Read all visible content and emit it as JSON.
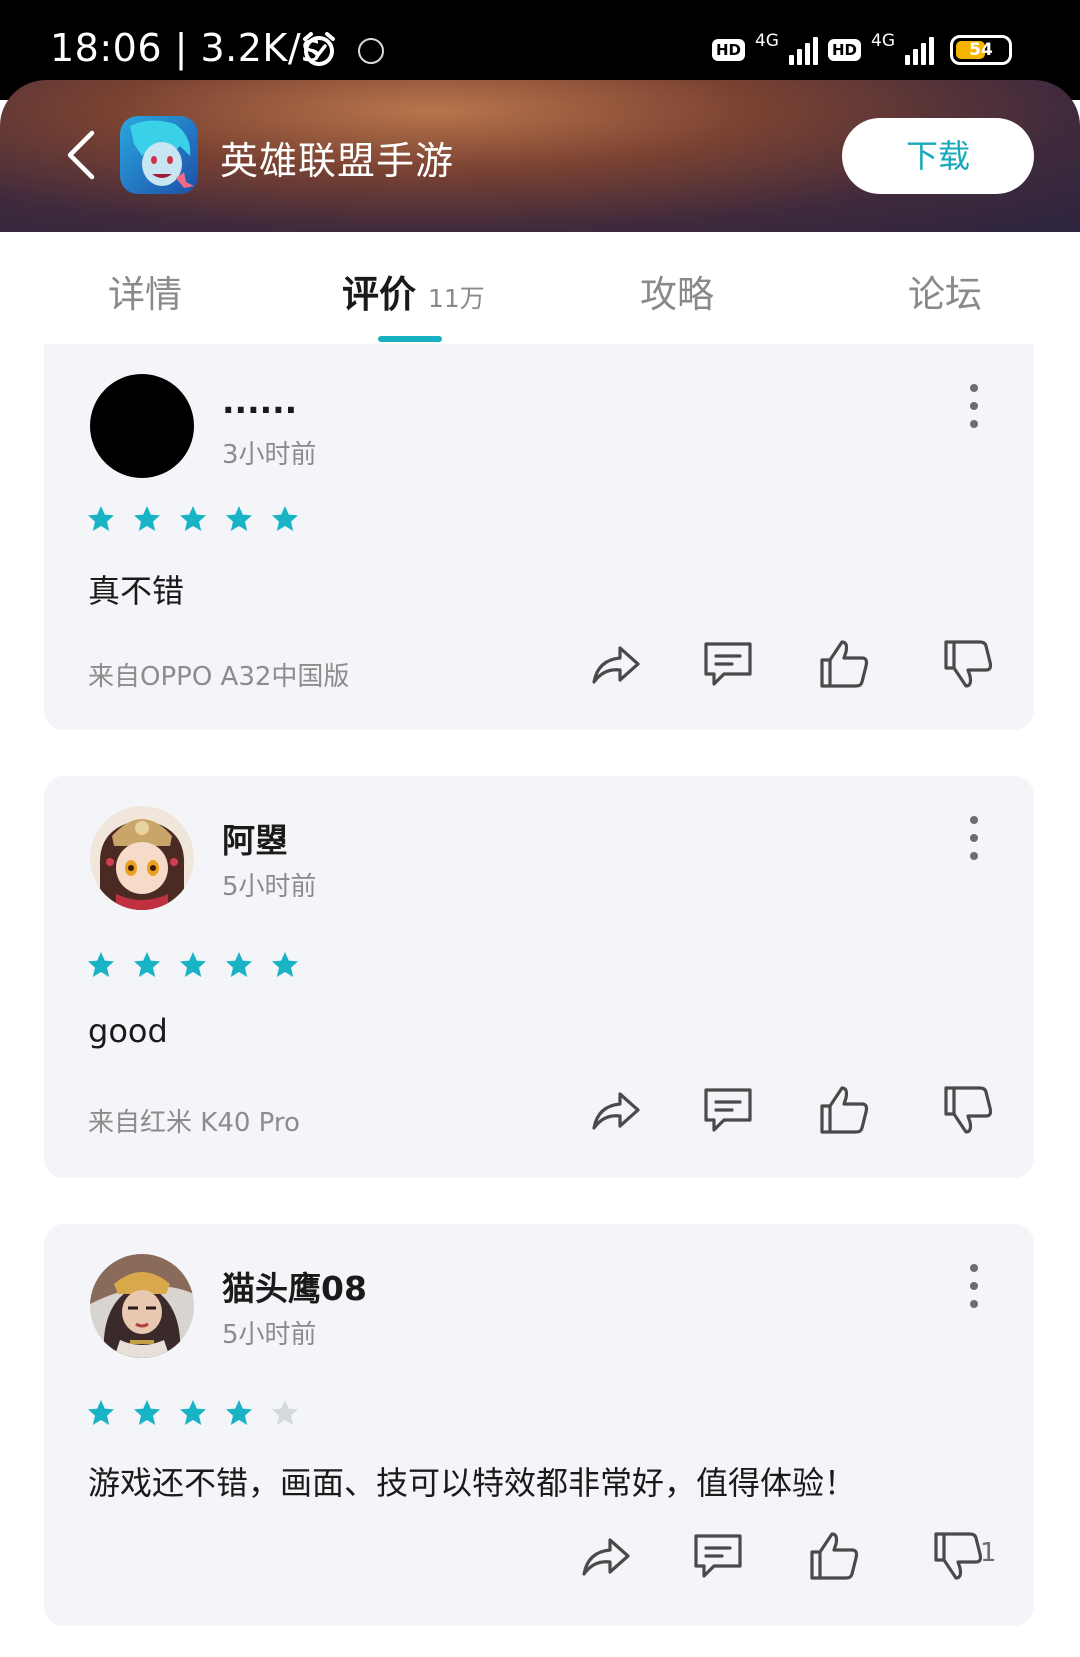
{
  "status_bar": {
    "time": "18:06 | 3.2K/s",
    "hd_label": "HD",
    "network_label": "4G",
    "battery": "54"
  },
  "header": {
    "app_title": "英雄联盟手游",
    "download_label": "下载"
  },
  "tabs": {
    "details": "详情",
    "reviews": "评价",
    "reviews_count": "11万",
    "guides": "攻略",
    "forum": "论坛"
  },
  "reviews": [
    {
      "username": "......",
      "time": "3小时前",
      "rating": 5,
      "text": "真不错",
      "device": "来自OPPO A32中国版"
    },
    {
      "username": "阿曌",
      "time": "5小时前",
      "rating": 5,
      "text": "good",
      "device": "来自红米 K40 Pro"
    },
    {
      "username": "猫头鹰08",
      "time": "5小时前",
      "rating": 4,
      "text": "游戏还不错，画面、技可以特效都非常好，值得体验！",
      "device": "",
      "dislike_count": "1"
    }
  ],
  "colors": {
    "accent": "#17b0c0",
    "star_active": "#19b3c6",
    "star_inactive": "#d5d8dc"
  }
}
